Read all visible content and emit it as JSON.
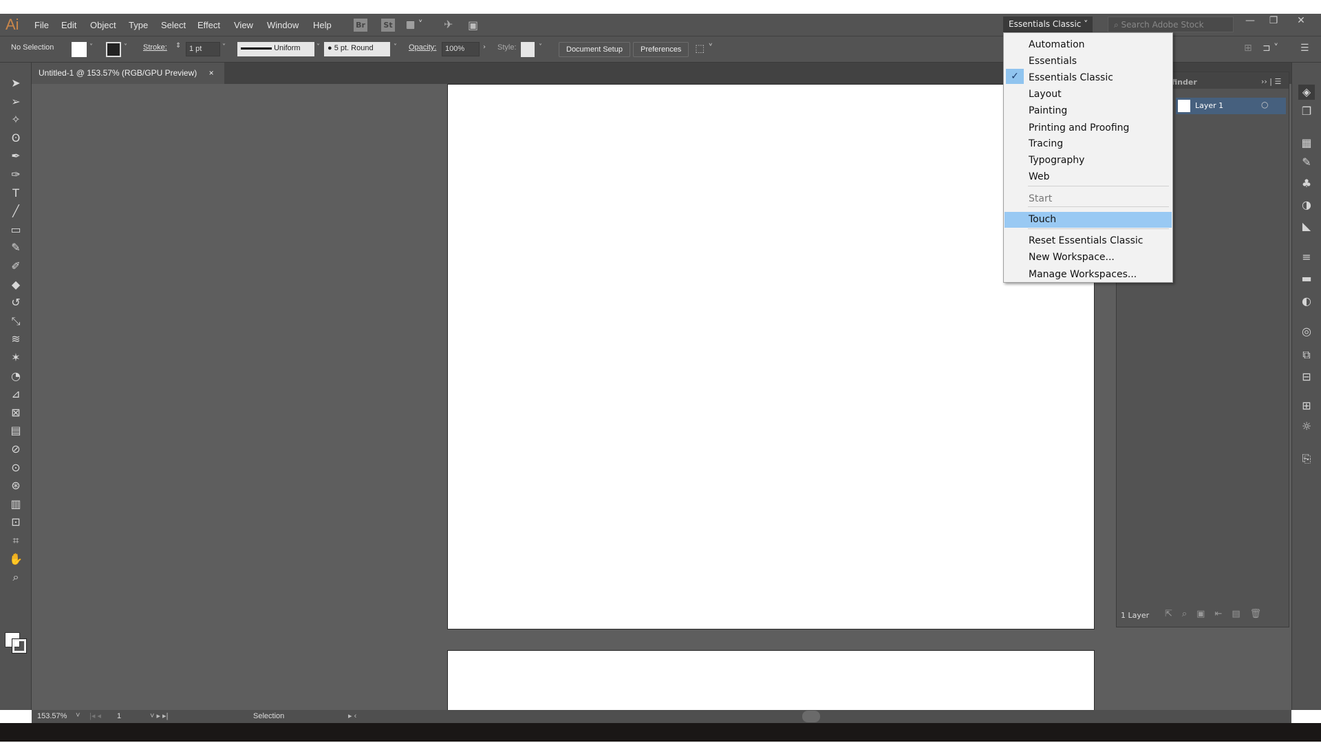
{
  "app": {
    "logo": "Ai"
  },
  "menubar": {
    "items": [
      "File",
      "Edit",
      "Object",
      "Type",
      "Select",
      "Effect",
      "View",
      "Window",
      "Help"
    ],
    "icons": [
      "Br",
      "St"
    ]
  },
  "control": {
    "selection": "No Selection",
    "stroke_label": "Stroke:",
    "stroke_value": "1 pt",
    "profile": "Uniform",
    "brush": "5 pt. Round",
    "opacity_label": "Opacity:",
    "opacity_value": "100%",
    "style_label": "Style:",
    "document_setup": "Document Setup",
    "preferences": "Preferences"
  },
  "tab": {
    "title": "Untitled-1 @ 153.57% (RGB/GPU Preview)",
    "close": "×"
  },
  "workspace": {
    "current": "Essentials Classic",
    "search_placeholder": "Search Adobe Stock"
  },
  "dropdown": {
    "groups": [
      [
        "Automation",
        "Essentials",
        "Essentials Classic",
        "Layout",
        "Painting",
        "Printing and Proofing",
        "Tracing",
        "Typography",
        "Web"
      ],
      [
        "Start"
      ],
      [
        "Touch"
      ],
      [
        "Reset Essentials Classic",
        "New Workspace...",
        "Manage Workspaces..."
      ]
    ],
    "checked": "Essentials Classic",
    "highlighted": "Touch",
    "disabled": "Start",
    "highlight_color": "#99c9f3"
  },
  "layers": {
    "tab": "finder",
    "layer_name": "Layer 1",
    "count": "1 Layer"
  },
  "status": {
    "zoom": "153.57%",
    "page": "1",
    "tool": "Selection"
  },
  "tools": [
    "selection-tool",
    "direct-selection-tool",
    "magic-wand-tool",
    "lasso-tool",
    "pen-tool",
    "curvature-tool",
    "type-tool",
    "line-tool",
    "rectangle-tool",
    "paintbrush-tool",
    "blob-brush-tool",
    "eraser-tool",
    "rotate-tool",
    "scale-tool",
    "warp-tool",
    "puppet-warp-tool",
    "shape-builder-tool",
    "perspective-grid-tool",
    "mesh-tool",
    "gradient-tool",
    "eyedropper-tool",
    "blend-tool",
    "symbol-sprayer-tool",
    "column-graph-tool",
    "artboard-tool",
    "slice-tool",
    "hand-tool",
    "zoom-tool"
  ],
  "panel_icons": [
    "layers-icon",
    "artboards-icon",
    "libraries-icon",
    "brushes-icon",
    "symbols-icon",
    "graphic-styles-icon",
    "appearance-icon",
    "stroke-icon",
    "gradient-icon",
    "transparency-icon",
    "color-icon",
    "transform-icon",
    "pathfinder-icon",
    "align-icon",
    "navigator-icon",
    "export-icon"
  ]
}
